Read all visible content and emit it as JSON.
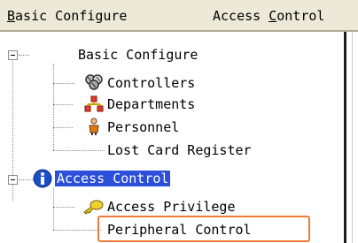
{
  "menubar": {
    "basic_configure": "Basic Configure",
    "basic_configure_accel": "B",
    "access_control": "Access Control",
    "access_control_accel": "C"
  },
  "tree": {
    "nodes": [
      {
        "label": "Basic Configure",
        "icon": "none"
      },
      {
        "label": "Controllers",
        "icon": "controllers-icon"
      },
      {
        "label": "Departments",
        "icon": "departments-icon"
      },
      {
        "label": "Personnel",
        "icon": "personnel-icon"
      },
      {
        "label": "Lost Card Register",
        "icon": "none"
      },
      {
        "label": "Access Control",
        "icon": "info-icon",
        "selected": true
      },
      {
        "label": "Access Privilege",
        "icon": "key-icon"
      },
      {
        "label": "Peripheral Control",
        "icon": "none",
        "highlighted": true
      }
    ]
  },
  "colors": {
    "selection": "#2b4fd8",
    "highlight_border": "#f07a3a",
    "menubar_bg": "#ece9d8"
  }
}
